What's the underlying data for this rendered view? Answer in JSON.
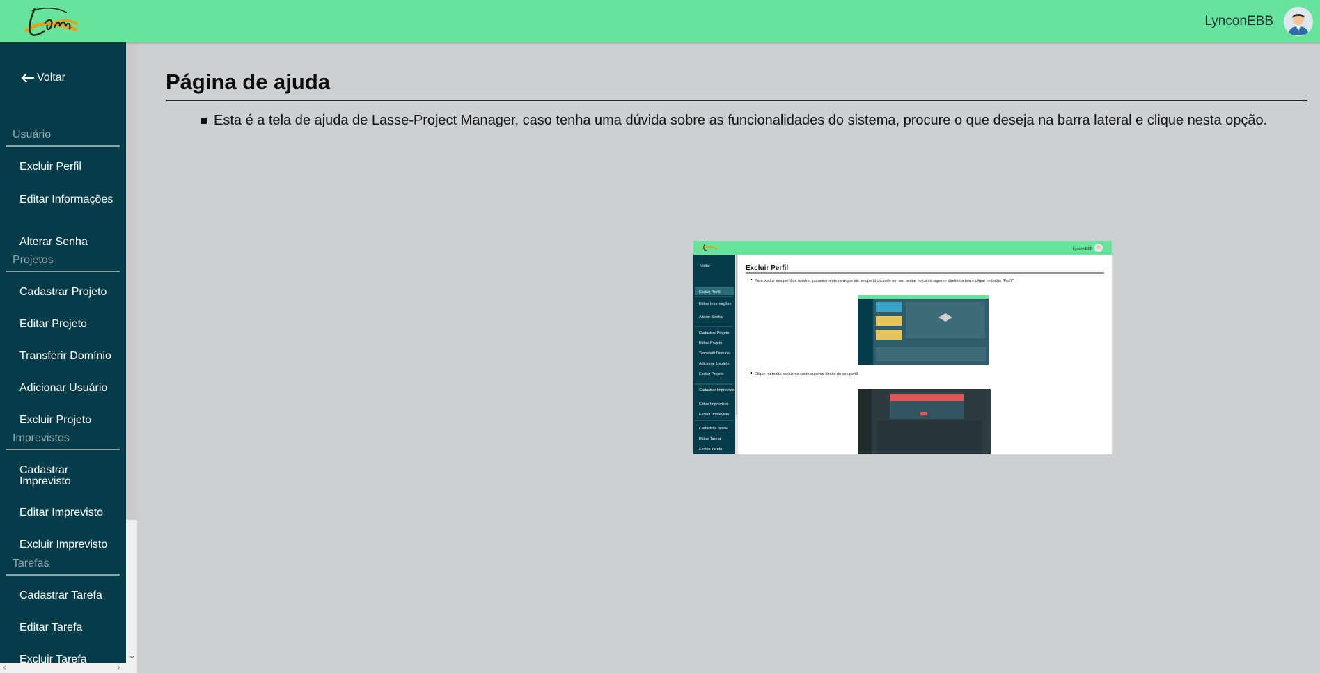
{
  "header": {
    "logo_text": "Lpm",
    "username": "LynconEBB",
    "background": "#68e39c"
  },
  "sidebar": {
    "back_label": "Voltar",
    "sections": [
      {
        "title": "Usuário",
        "items": [
          "Excluir Perfil",
          "Editar Informações",
          "Alterar Senha"
        ]
      },
      {
        "title": "Projetos",
        "items": [
          "Cadastrar Projeto",
          "Editar Projeto",
          "Transferir Domínio",
          "Adicionar Usuário",
          "Excluir Projeto"
        ]
      },
      {
        "title": "Imprevistos",
        "items": [
          "Cadastrar Imprevisto",
          "Editar Imprevisto",
          "Excluir Imprevisto"
        ]
      },
      {
        "title": "Tarefas",
        "items": [
          "Cadastrar Tarefa",
          "Editar Tarefa",
          "Excluir Tarefa"
        ]
      }
    ],
    "background": "#053c4a"
  },
  "main": {
    "title": "Página de ajuda",
    "help_text": "Esta é a tela de ajuda de Lasse-Project Manager, caso tenha uma dúvida sobre as funcionalidades do sistema, procure o que deseja na barra lateral e clique nesta opção.",
    "screenshot": {
      "user": "LynconEBB",
      "back_label": "Voltar",
      "title": "Excluir Perfil",
      "text_1": "Para excluir seu perfil de usuário, primeiramente navegue até seu perfil clicando em seu avatar no canto superior direito da tela e clique no botão \"Perfil\".",
      "text_2": "Clique no botão excluir no canto superior direito do seu perfil",
      "menu": [
        "Excluir Perfil",
        "Editar Informações",
        "Alterar Senha",
        "Cadastrar Projeto",
        "Editar Projeto",
        "Transferir Domínio",
        "Adicionar Usuário",
        "Excluir Projeto",
        "Cadastrar Imprevisto",
        "Editar Imprevisto",
        "Excluir Imprevisto",
        "Cadastrar Tarefa",
        "Editar Tarefa",
        "Excluir Tarefa"
      ],
      "active_item": "Excluir Perfil"
    }
  }
}
